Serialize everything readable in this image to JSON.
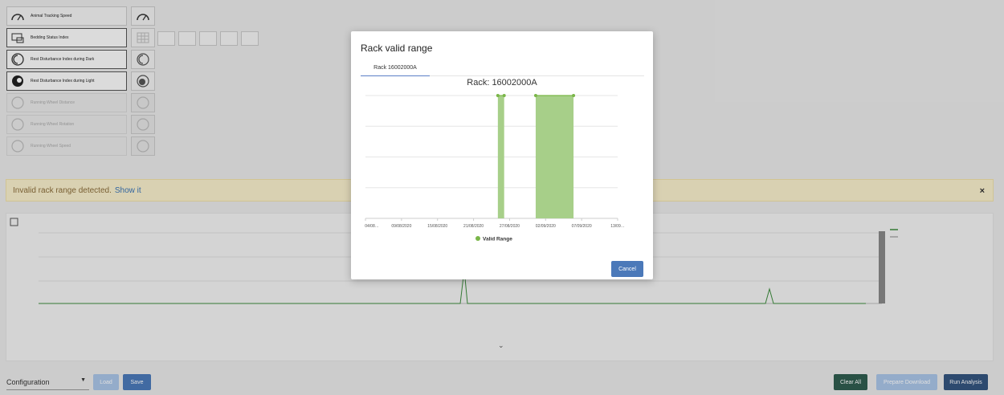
{
  "analyses": [
    {
      "label": "Animal Tracking Speed",
      "state": "normal",
      "icon": "speedometer-icon"
    },
    {
      "label": "Bedding Status Index",
      "state": "normal",
      "icon": "bedding-icon"
    },
    {
      "label": "Rest Disturbance Index during Dark",
      "state": "active",
      "icon": "moon-icon"
    },
    {
      "label": "Rest Disturbance Index during Light",
      "state": "active",
      "icon": "sun-icon"
    },
    {
      "label": "Running Wheel Distance",
      "state": "disabled",
      "icon": "wheel-icon"
    },
    {
      "label": "Running Wheel Rotation",
      "state": "disabled",
      "icon": "wheel-icon"
    },
    {
      "label": "Running Wheel Speed",
      "state": "disabled",
      "icon": "wheel-icon"
    }
  ],
  "alert": {
    "text": "Invalid rack range detected.",
    "link": "Show it",
    "close": "×"
  },
  "modal": {
    "title": "Rack valid range",
    "tab": "Rack 16002000A",
    "cancel": "Cancel"
  },
  "chart_data": {
    "type": "area",
    "title": "Rack: 16002000A",
    "x_ticks": [
      "04/08…",
      "09/08/2020",
      "15/08/2020",
      "21/08/2020",
      "27/08/2020",
      "02/09/2020",
      "07/09/2020",
      "13/09…"
    ],
    "series": [
      {
        "name": "Valid Range",
        "color": "#7ab648",
        "segments": [
          {
            "start": "25/08/2020",
            "end": "26/08/2020",
            "value": 1
          },
          {
            "start": "31/08/2020",
            "end": "06/09/2020",
            "value": 1
          }
        ]
      }
    ],
    "ylim": [
      0,
      1
    ],
    "grid": true,
    "legend": "bottom"
  },
  "bottom": {
    "config_label": "Configuration",
    "load": "Load",
    "save": "Save",
    "clear": "Clear All",
    "prepare": "Prepare Download",
    "run": "Run Analysis"
  },
  "colors": {
    "primary": "#4b79b9",
    "valid_range": "#7ab648",
    "alert_bg": "#f7eecb"
  }
}
